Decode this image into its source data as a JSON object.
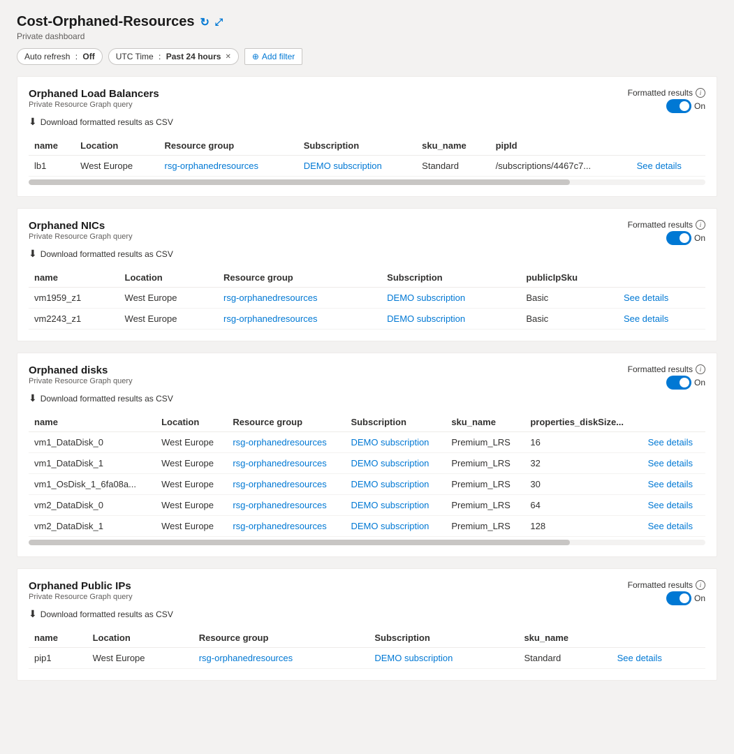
{
  "page": {
    "title": "Cost-Orphaned-Resources",
    "subtitle": "Private dashboard"
  },
  "toolbar": {
    "auto_refresh_label": "Auto refresh",
    "auto_refresh_value": "Off",
    "time_label": "UTC Time",
    "time_value": "Past 24 hours",
    "add_filter_label": "Add filter"
  },
  "sections": [
    {
      "id": "load-balancers",
      "title": "Orphaned Load Balancers",
      "subtitle": "Private Resource Graph query",
      "download_label": "Download formatted results as CSV",
      "formatted_results_label": "Formatted results",
      "toggle_label": "On",
      "columns": [
        "name",
        "Location",
        "Resource group",
        "Subscription",
        "sku_name",
        "pipId"
      ],
      "rows": [
        {
          "name": "lb1",
          "location": "West Europe",
          "resource_group": "rsg-orphanedresources",
          "resource_group_link": true,
          "subscription": "DEMO subscription",
          "subscription_link": true,
          "sku_name": "Standard",
          "pipid": "/subscriptions/4467c7...",
          "see_details": true
        }
      ]
    },
    {
      "id": "nics",
      "title": "Orphaned NICs",
      "subtitle": "Private Resource Graph query",
      "download_label": "Download formatted results as CSV",
      "formatted_results_label": "Formatted results",
      "toggle_label": "On",
      "columns": [
        "name",
        "Location",
        "Resource group",
        "Subscription",
        "publicIpSku"
      ],
      "rows": [
        {
          "name": "vm1959_z1",
          "location": "West Europe",
          "resource_group": "rsg-orphanedresources",
          "resource_group_link": true,
          "subscription": "DEMO subscription",
          "subscription_link": true,
          "sku_name": "Basic",
          "see_details": true
        },
        {
          "name": "vm2243_z1",
          "location": "West Europe",
          "resource_group": "rsg-orphanedresources",
          "resource_group_link": true,
          "subscription": "DEMO subscription",
          "subscription_link": true,
          "sku_name": "Basic",
          "see_details": true
        }
      ]
    },
    {
      "id": "disks",
      "title": "Orphaned disks",
      "subtitle": "Private Resource Graph query",
      "download_label": "Download formatted results as CSV",
      "formatted_results_label": "Formatted results",
      "toggle_label": "On",
      "columns": [
        "name",
        "Location",
        "Resource group",
        "Subscription",
        "sku_name",
        "properties_diskSize..."
      ],
      "rows": [
        {
          "name": "vm1_DataDisk_0",
          "location": "West Europe",
          "resource_group": "rsg-orphanedresources",
          "resource_group_link": true,
          "subscription": "DEMO subscription",
          "subscription_link": true,
          "sku_name": "Premium_LRS",
          "disk_size": "16",
          "see_details": true
        },
        {
          "name": "vm1_DataDisk_1",
          "location": "West Europe",
          "resource_group": "rsg-orphanedresources",
          "resource_group_link": true,
          "subscription": "DEMO subscription",
          "subscription_link": true,
          "sku_name": "Premium_LRS",
          "disk_size": "32",
          "see_details": true
        },
        {
          "name": "vm1_OsDisk_1_6fa08a...",
          "location": "West Europe",
          "resource_group": "rsg-orphanedresources",
          "resource_group_link": true,
          "subscription": "DEMO subscription",
          "subscription_link": true,
          "sku_name": "Premium_LRS",
          "disk_size": "30",
          "see_details": true
        },
        {
          "name": "vm2_DataDisk_0",
          "location": "West Europe",
          "resource_group": "rsg-orphanedresources",
          "resource_group_link": true,
          "subscription": "DEMO subscription",
          "subscription_link": true,
          "sku_name": "Premium_LRS",
          "disk_size": "64",
          "see_details": true
        },
        {
          "name": "vm2_DataDisk_1",
          "location": "West Europe",
          "resource_group": "rsg-orphanedresources",
          "resource_group_link": true,
          "subscription": "DEMO subscription",
          "subscription_link": true,
          "sku_name": "Premium_LRS",
          "disk_size": "128",
          "see_details": true
        }
      ]
    },
    {
      "id": "public-ips",
      "title": "Orphaned Public IPs",
      "subtitle": "Private Resource Graph query",
      "download_label": "Download formatted results as CSV",
      "formatted_results_label": "Formatted results",
      "toggle_label": "On",
      "columns": [
        "name",
        "Location",
        "Resource group",
        "Subscription",
        "sku_name"
      ],
      "rows": [
        {
          "name": "pip1",
          "location": "West Europe",
          "resource_group": "rsg-orphanedresources",
          "resource_group_link": true,
          "subscription": "DEMO subscription",
          "subscription_link": true,
          "sku_name": "Standard",
          "see_details": true
        }
      ]
    }
  ]
}
